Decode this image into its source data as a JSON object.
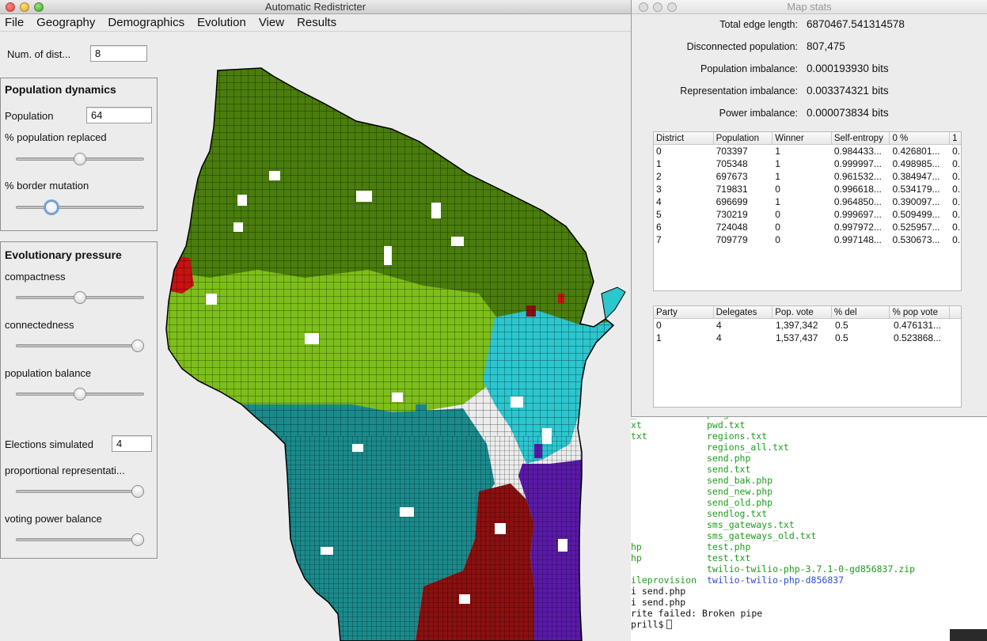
{
  "main_window": {
    "title": "Automatic Redistricter",
    "menu": [
      "File",
      "Geography",
      "Demographics",
      "Evolution",
      "View",
      "Results"
    ]
  },
  "controls": {
    "num_districts_label": "Num. of dist...",
    "num_districts_value": "8",
    "population_dynamics": {
      "title": "Population dynamics",
      "population_label": "Population",
      "population_value": "64",
      "pct_replaced_label": "% population replaced",
      "pct_replaced_level": 0.5,
      "border_mutation_label": "% border mutation",
      "border_mutation_level": 0.25
    },
    "evolutionary_pressure": {
      "title": "Evolutionary pressure",
      "compactness_label": "compactness",
      "compactness_level": 0.5,
      "connectedness_label": "connectedness",
      "connectedness_level": 1.0,
      "population_balance_label": "population balance",
      "population_balance_level": 0.5,
      "elections_label": "Elections simulated",
      "elections_value": "4",
      "proportional_label": "proportional representati...",
      "proportional_level": 1.0,
      "voting_power_label": "voting power balance",
      "voting_power_level": 1.0
    }
  },
  "map": {
    "district_colors": {
      "north": "#4a7d0c",
      "central": "#7dbf1a",
      "southwest": "#1b8a8c",
      "east": "#2cc6cf",
      "south_central": "#8b1010",
      "southeast": "#5a1aa8",
      "west_patch": "#c81212"
    }
  },
  "stats_window": {
    "title": "Map stats",
    "stats": [
      {
        "label": "Total edge length:",
        "value": "6870467.541314578"
      },
      {
        "label": "Disconnected population:",
        "value": "807,475"
      },
      {
        "label": "Population imbalance:",
        "value": "0.000193930 bits"
      },
      {
        "label": "Representation imbalance:",
        "value": "0.003374321 bits"
      },
      {
        "label": "Power imbalance:",
        "value": "0.000073834 bits"
      }
    ],
    "district_table": {
      "headers": [
        "District",
        "Population",
        "Winner",
        "Self-entropy",
        "0 %",
        "1"
      ],
      "rows": [
        [
          "0",
          "703397",
          "1",
          "0.984433...",
          "0.426801...",
          "0."
        ],
        [
          "1",
          "705348",
          "1",
          "0.999997...",
          "0.498985...",
          "0."
        ],
        [
          "2",
          "697673",
          "1",
          "0.961532...",
          "0.384947...",
          "0."
        ],
        [
          "3",
          "719831",
          "0",
          "0.996618...",
          "0.534179...",
          "0."
        ],
        [
          "4",
          "696699",
          "1",
          "0.964850...",
          "0.390097...",
          "0."
        ],
        [
          "5",
          "730219",
          "0",
          "0.999697...",
          "0.509499...",
          "0."
        ],
        [
          "6",
          "724048",
          "0",
          "0.997972...",
          "0.525957...",
          "0."
        ],
        [
          "7",
          "709779",
          "0",
          "0.997148...",
          "0.530673...",
          "0."
        ]
      ]
    },
    "party_table": {
      "headers": [
        "Party",
        "Delegates",
        "Pop. vote",
        "% del",
        "% pop vote"
      ],
      "rows": [
        [
          "0",
          "4",
          "1,397,342",
          "0.5",
          "0.476131..."
        ],
        [
          "1",
          "4",
          "1,537,437",
          "0.5",
          "0.523868..."
        ]
      ]
    }
  },
  "terminal": {
    "right_column": [
      "ping.txt",
      "pwd.txt",
      "regions.txt",
      "regions_all.txt",
      "send.php",
      "send.txt",
      "send_bak.php",
      "send_new.php",
      "send_old.php",
      "sendlog.txt",
      "sms_gateways.txt",
      "sms_gateways_old.txt",
      "test.php",
      "test.txt",
      "twilio-twilio-php-3.7.1-0-gd856837.zip",
      "twilio-twilio-php-d856837"
    ],
    "left_column": [
      "_new.txt",
      "xt",
      "txt",
      "hp",
      "hp",
      "ileprovision"
    ],
    "tail_lines": [
      "i send.php",
      "i send.php",
      "rite failed: Broken pipe",
      "prill$"
    ]
  }
}
